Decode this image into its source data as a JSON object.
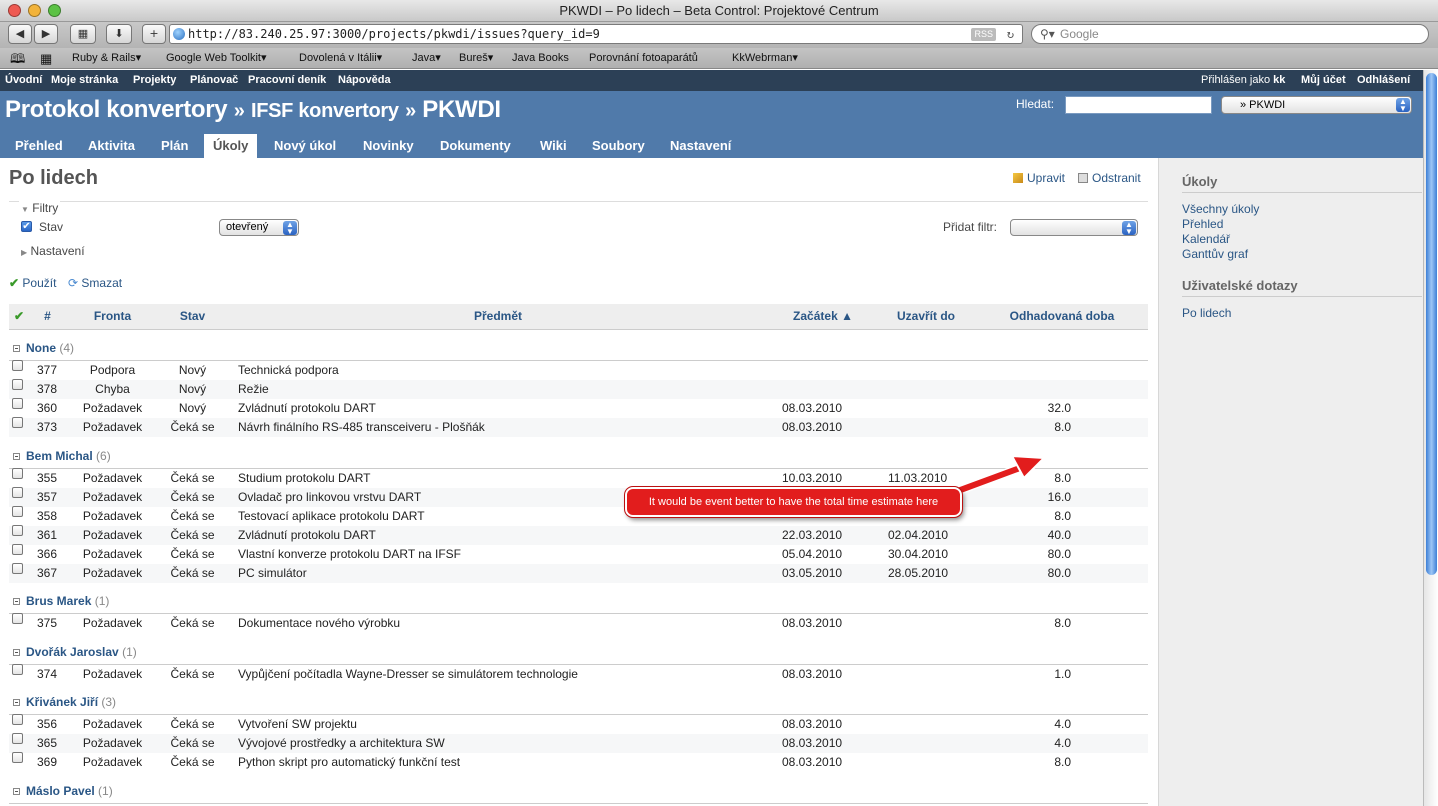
{
  "window": {
    "title": "PKWDI – Po lidech – Beta Control: Projektové Centrum"
  },
  "browser": {
    "url": "http://83.240.25.97:3000/projects/pkwdi/issues?query_id=9",
    "rss": "RSS",
    "search_placeholder": "Google",
    "bookmarks": [
      "Ruby & Rails▾",
      "Google Web Toolkit▾",
      "Dovolená v Itálii▾",
      "Java▾",
      "Bureš▾",
      "Java Books",
      "Porovnání fotoaparátů",
      "KkWebrman▾"
    ]
  },
  "topmenu": {
    "items": [
      "Úvodní",
      "Moje stránka",
      "Projekty",
      "Plánovač",
      "Pracovní deník",
      "Nápověda"
    ],
    "logged_prefix": "Přihlášen jako",
    "user": "kk",
    "my_account": "Můj účet",
    "logout": "Odhlášení"
  },
  "header": {
    "title_a": "Protokol konvertory",
    "sep": "»",
    "title_b": "IFSF konvertory",
    "title_c": "PKWDI",
    "search_label": "Hledat:",
    "project_select": "» PKWDI"
  },
  "tabs": [
    "Přehled",
    "Aktivita",
    "Plán",
    "Úkoly",
    "Nový úkol",
    "Novinky",
    "Dokumenty",
    "Wiki",
    "Soubory",
    "Nastavení"
  ],
  "page": {
    "title": "Po lidech",
    "edit": "Upravit",
    "delete": "Odstranit",
    "filters_legend": "Filtry",
    "filter_status_label": "Stav",
    "filter_status_value": "otevřený",
    "add_filter_label": "Přidat filtr:",
    "options_legend": "Nastavení",
    "apply": "Použít",
    "clear": "Smazat"
  },
  "table": {
    "headers": {
      "check": "✔",
      "id": "#",
      "tracker": "Fronta",
      "status": "Stav",
      "subject": "Předmět",
      "start": "Začátek ▲",
      "due": "Uzavřít do",
      "estimate": "Odhadovaná doba"
    },
    "groups": [
      {
        "name": "None",
        "count": "(4)",
        "rows": [
          {
            "id": "377",
            "tracker": "Podpora",
            "status": "Nový",
            "subject": "Technická podpora",
            "start": "",
            "due": "",
            "estimate": ""
          },
          {
            "id": "378",
            "tracker": "Chyba",
            "status": "Nový",
            "subject": "Režie",
            "start": "",
            "due": "",
            "estimate": ""
          },
          {
            "id": "360",
            "tracker": "Požadavek",
            "status": "Nový",
            "subject": "Zvládnutí protokolu DART",
            "start": "08.03.2010",
            "due": "",
            "estimate": "32.0"
          },
          {
            "id": "373",
            "tracker": "Požadavek",
            "status": "Čeká se",
            "subject": "Návrh finálního RS-485 transceiveru - Plošňák",
            "start": "08.03.2010",
            "due": "",
            "estimate": "8.0"
          }
        ]
      },
      {
        "name": "Bem Michal",
        "count": "(6)",
        "rows": [
          {
            "id": "355",
            "tracker": "Požadavek",
            "status": "Čeká se",
            "subject": "Studium protokolu DART",
            "start": "10.03.2010",
            "due": "11.03.2010",
            "estimate": "8.0"
          },
          {
            "id": "357",
            "tracker": "Požadavek",
            "status": "Čeká se",
            "subject": "Ovladač pro linkovou vrstvu DART",
            "start": "",
            "due": "",
            "estimate": "16.0"
          },
          {
            "id": "358",
            "tracker": "Požadavek",
            "status": "Čeká se",
            "subject": "Testovací aplikace protokolu DART",
            "start": "",
            "due": "",
            "estimate": "8.0"
          },
          {
            "id": "361",
            "tracker": "Požadavek",
            "status": "Čeká se",
            "subject": "Zvládnutí protokolu DART",
            "start": "22.03.2010",
            "due": "02.04.2010",
            "estimate": "40.0"
          },
          {
            "id": "366",
            "tracker": "Požadavek",
            "status": "Čeká se",
            "subject": "Vlastní konverze protokolu DART na IFSF",
            "start": "05.04.2010",
            "due": "30.04.2010",
            "estimate": "80.0"
          },
          {
            "id": "367",
            "tracker": "Požadavek",
            "status": "Čeká se",
            "subject": "PC simulátor",
            "start": "03.05.2010",
            "due": "28.05.2010",
            "estimate": "80.0"
          }
        ]
      },
      {
        "name": "Brus Marek",
        "count": "(1)",
        "rows": [
          {
            "id": "375",
            "tracker": "Požadavek",
            "status": "Čeká se",
            "subject": "Dokumentace nového výrobku",
            "start": "08.03.2010",
            "due": "",
            "estimate": "8.0"
          }
        ]
      },
      {
        "name": "Dvořák Jaroslav",
        "count": "(1)",
        "rows": [
          {
            "id": "374",
            "tracker": "Požadavek",
            "status": "Čeká se",
            "subject": "Vypůjčení počítadla Wayne-Dresser se simulátorem technologie",
            "start": "08.03.2010",
            "due": "",
            "estimate": "1.0"
          }
        ]
      },
      {
        "name": "Křivánek Jiří",
        "count": "(3)",
        "rows": [
          {
            "id": "356",
            "tracker": "Požadavek",
            "status": "Čeká se",
            "subject": "Vytvoření SW projektu",
            "start": "08.03.2010",
            "due": "",
            "estimate": "4.0"
          },
          {
            "id": "365",
            "tracker": "Požadavek",
            "status": "Čeká se",
            "subject": "Vývojové prostředky a architektura SW",
            "start": "08.03.2010",
            "due": "",
            "estimate": "4.0"
          },
          {
            "id": "369",
            "tracker": "Požadavek",
            "status": "Čeká se",
            "subject": "Python skript pro automatický funkční test",
            "start": "08.03.2010",
            "due": "",
            "estimate": "8.0"
          }
        ]
      },
      {
        "name": "Máslo Pavel",
        "count": "(1)",
        "rows": []
      }
    ]
  },
  "sidebar": {
    "issues_title": "Úkoly",
    "links": [
      "Všechny úkoly",
      "Přehled",
      "Kalendář",
      "Ganttův graf"
    ],
    "queries_title": "Uživatelské dotazy",
    "query_link": "Po lidech"
  },
  "annotation": {
    "text": "It would be event better to have the total time estimate here"
  },
  "colors": {
    "header": "#507aaa",
    "topmenu": "#2c4056",
    "link": "#2a5685",
    "callout": "#e21d1d"
  }
}
